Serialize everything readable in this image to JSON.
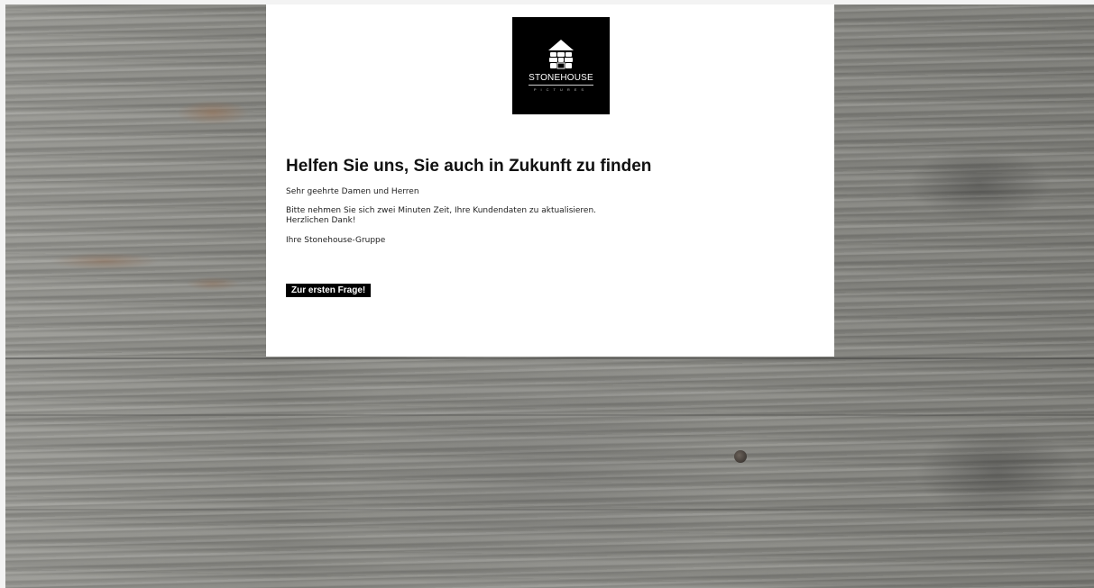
{
  "logo": {
    "brand": "STONEHOUSE",
    "sub": "PICTURES",
    "icon": "stone-house-icon"
  },
  "content": {
    "headline": "Helfen Sie uns, Sie auch in Zukunft zu finden",
    "greeting": "Sehr geehrte Damen und Herren",
    "request_line1": "Bitte nehmen Sie sich zwei Minuten Zeit, Ihre Kundendaten zu aktualisieren.",
    "request_line2": "Herzlichen Dank!",
    "signature": "Ihre Stonehouse-Gruppe"
  },
  "cta": {
    "label": "Zur ersten Frage!"
  },
  "colors": {
    "card_bg": "#ffffff",
    "logo_bg": "#000000",
    "button_bg": "#000000",
    "button_text": "#ffffff"
  }
}
